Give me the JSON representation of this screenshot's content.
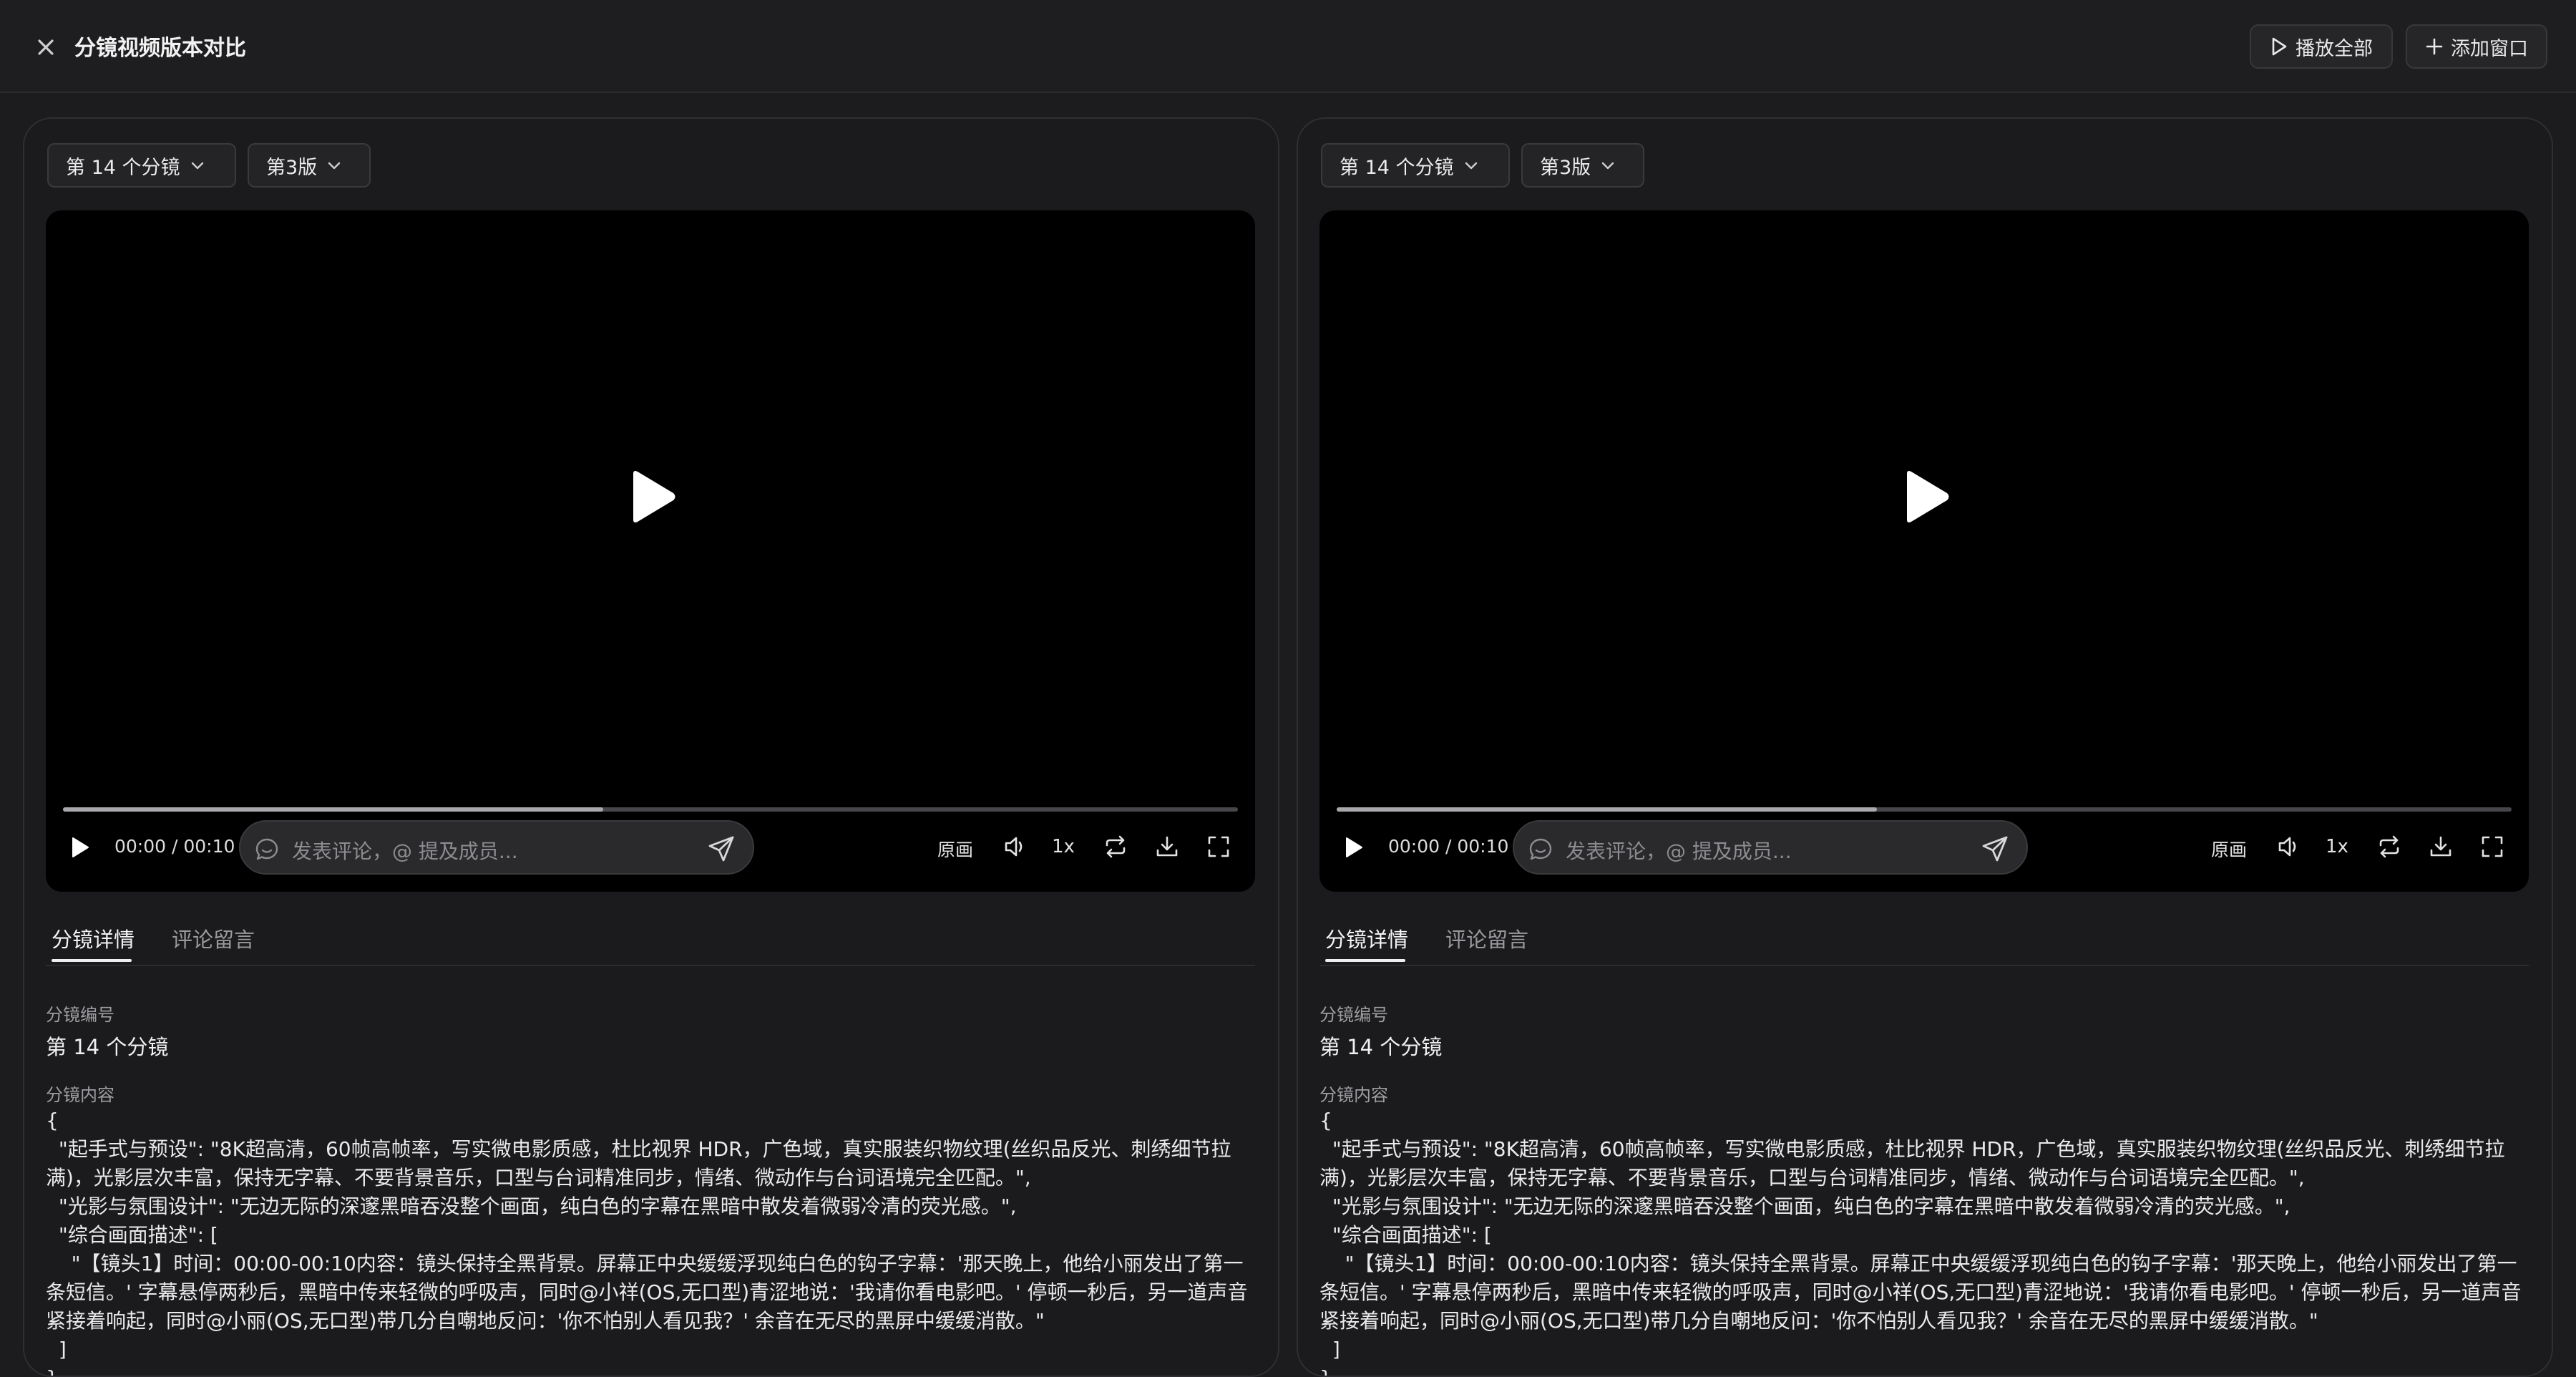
{
  "header": {
    "title": "分镜视频版本对比",
    "play_all_label": "播放全部",
    "add_window_label": "添加窗口"
  },
  "panels": [
    {
      "shot_select": "第 14 个分镜",
      "version_select": "第3版",
      "video": {
        "time": "00:00 / 00:10",
        "progress_fraction": 0.46,
        "comment_placeholder": "发表评论，@ 提及成员...",
        "quality_label": "原画",
        "rate_label": "1x"
      },
      "tabs": [
        "分镜详情",
        "评论留言"
      ],
      "details": {
        "number_label": "分镜编号",
        "number_value": "第 14 个分镜",
        "content_label": "分镜内容",
        "content_text": "{\n  \"起手式与预设\": \"8K超高清，60帧高帧率，写实微电影质感，杜比视界 HDR，广色域，真实服装织物纹理(丝织品反光、刺绣细节拉满)，光影层次丰富，保持无字幕、不要背景音乐，口型与台词精准同步，情绪、微动作与台词语境完全匹配。\",\n  \"光影与氛围设计\": \"无边无际的深邃黑暗吞没整个画面，纯白色的字幕在黑暗中散发着微弱冷清的荧光感。\",\n  \"综合画面描述\": [\n    \"【镜头1】时间：00:00-00:10内容：镜头保持全黑背景。屏幕正中央缓缓浮现纯白色的钩子字幕：'那天晚上，他给小丽发出了第一条短信。' 字幕悬停两秒后，黑暗中传来轻微的呼吸声，同时@小祥(OS,无口型)青涩地说：'我请你看电影吧。' 停顿一秒后，另一道声音紧接着响起，同时@小丽(OS,无口型)带几分自嘲地反问：'你不怕别人看见我？' 余音在无尽的黑屏中缓缓消散。\"\n  ]\n}"
      }
    },
    {
      "shot_select": "第 14 个分镜",
      "version_select": "第3版",
      "video": {
        "time": "00:00 / 00:10",
        "progress_fraction": 0.46,
        "comment_placeholder": "发表评论，@ 提及成员...",
        "quality_label": "原画",
        "rate_label": "1x"
      },
      "tabs": [
        "分镜详情",
        "评论留言"
      ],
      "details": {
        "number_label": "分镜编号",
        "number_value": "第 14 个分镜",
        "content_label": "分镜内容",
        "content_text": "{\n  \"起手式与预设\": \"8K超高清，60帧高帧率，写实微电影质感，杜比视界 HDR，广色域，真实服装织物纹理(丝织品反光、刺绣细节拉满)，光影层次丰富，保持无字幕、不要背景音乐，口型与台词精准同步，情绪、微动作与台词语境完全匹配。\",\n  \"光影与氛围设计\": \"无边无际的深邃黑暗吞没整个画面，纯白色的字幕在黑暗中散发着微弱冷清的荧光感。\",\n  \"综合画面描述\": [\n    \"【镜头1】时间：00:00-00:10内容：镜头保持全黑背景。屏幕正中央缓缓浮现纯白色的钩子字幕：'那天晚上，他给小丽发出了第一条短信。' 字幕悬停两秒后，黑暗中传来轻微的呼吸声，同时@小祥(OS,无口型)青涩地说：'我请你看电影吧。' 停顿一秒后，另一道声音紧接着响起，同时@小丽(OS,无口型)带几分自嘲地反问：'你不怕别人看见我？' 余音在无尽的黑屏中缓缓消散。\"\n  ]\n}"
      }
    }
  ],
  "icons": {
    "close": "close-icon",
    "play_all": "play-icon",
    "add_window": "plus-icon",
    "dropdown": "chevron-down-icon",
    "big_play": "play-icon",
    "comment": "chat-bubble-icon",
    "send": "send-icon",
    "volume": "volume-icon",
    "loop": "loop-icon",
    "download": "download-icon",
    "fullscreen": "fullscreen-icon"
  }
}
